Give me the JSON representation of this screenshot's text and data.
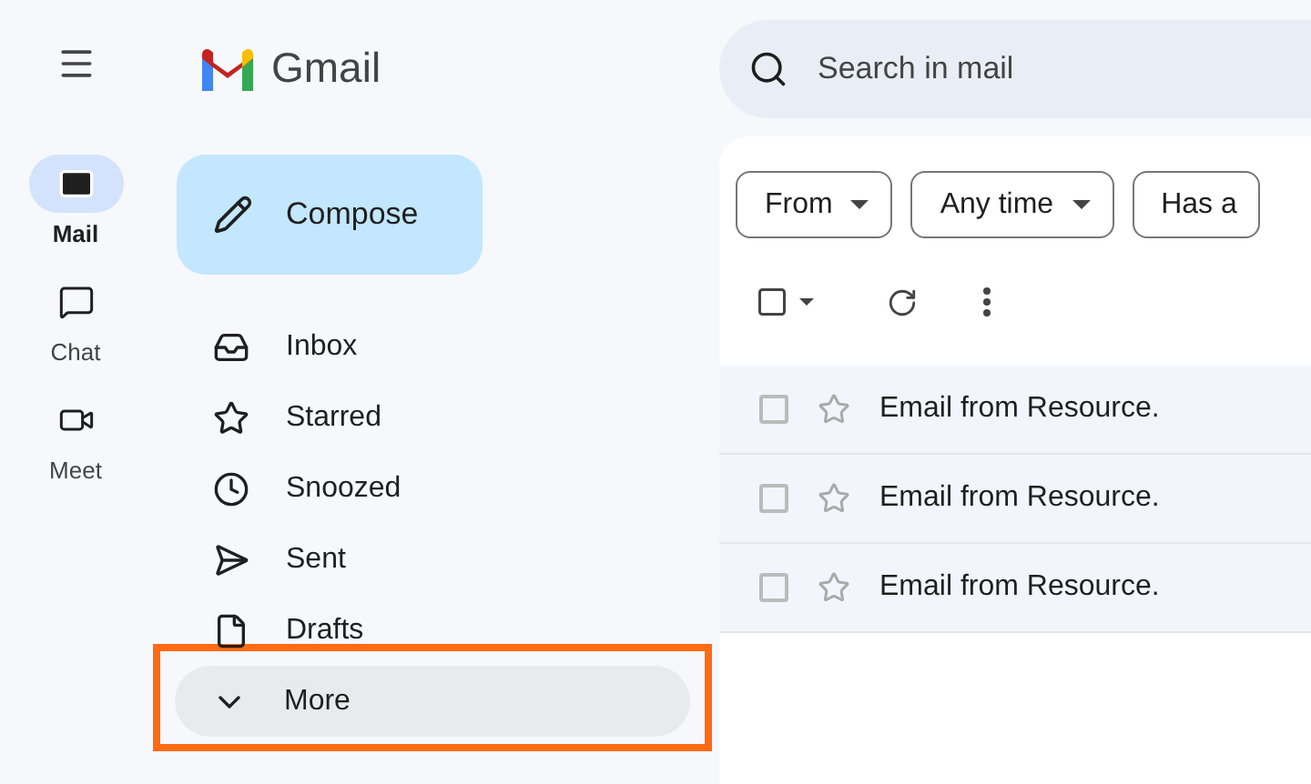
{
  "rail": {
    "items": [
      {
        "kind": "mail",
        "label": "Mail",
        "selected": true
      },
      {
        "kind": "chat",
        "label": "Chat",
        "selected": false
      },
      {
        "kind": "meet",
        "label": "Meet",
        "selected": false
      }
    ]
  },
  "brand": {
    "name": "Gmail"
  },
  "compose": {
    "label": "Compose"
  },
  "sidebar": {
    "items": [
      {
        "kind": "inbox",
        "label": "Inbox",
        "selected": false,
        "highlighted": false
      },
      {
        "kind": "starred",
        "label": "Starred",
        "selected": false,
        "highlighted": false
      },
      {
        "kind": "snoozed",
        "label": "Snoozed",
        "selected": false,
        "highlighted": false
      },
      {
        "kind": "sent",
        "label": "Sent",
        "selected": false,
        "highlighted": false
      },
      {
        "kind": "drafts",
        "label": "Drafts",
        "selected": false,
        "highlighted": false
      },
      {
        "kind": "more",
        "label": "More",
        "selected": true,
        "highlighted": true
      }
    ]
  },
  "search": {
    "placeholder": "Search in mail"
  },
  "toolbar": {
    "select_all_checked": false
  },
  "filters": [
    {
      "label": "From",
      "dropdown": true
    },
    {
      "label": "Any time",
      "dropdown": true
    },
    {
      "label": "Has a",
      "dropdown": false
    }
  ],
  "emails": [
    {
      "subject": "Email from Resource.",
      "checked": false,
      "starred": false
    },
    {
      "subject": "Email from Resource.",
      "checked": false,
      "starred": false
    },
    {
      "subject": "Email from Resource.",
      "checked": false,
      "starred": false
    }
  ]
}
